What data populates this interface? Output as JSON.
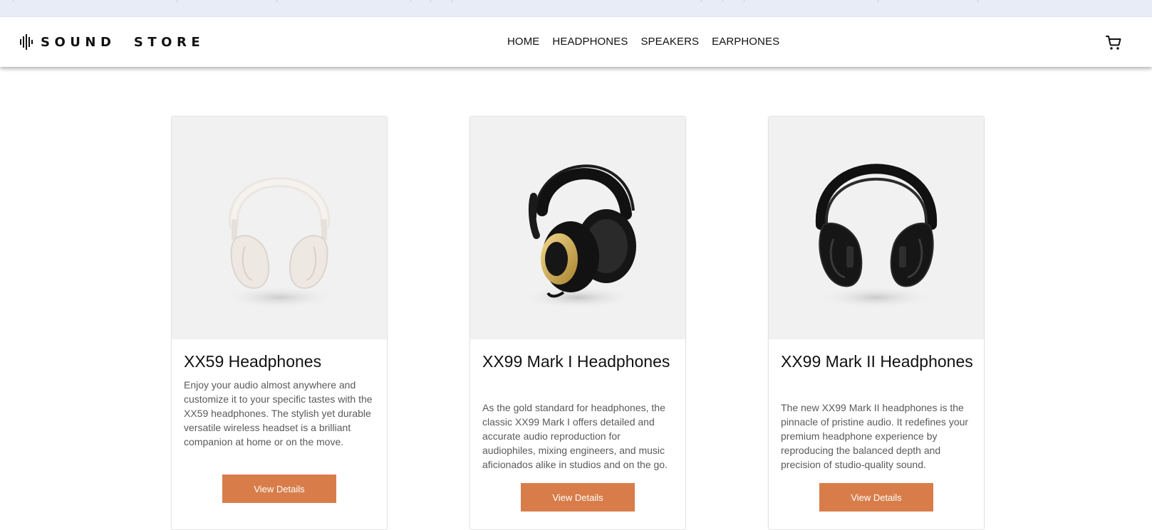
{
  "brand": {
    "logo_text": "SOUND  STORE",
    "logo_icon": "sound-wave-icon"
  },
  "nav": {
    "items": [
      {
        "label": "HOME"
      },
      {
        "label": "HEADPHONES"
      },
      {
        "label": "SPEAKERS"
      },
      {
        "label": "EARPHONES"
      }
    ],
    "cart_icon": "shopping-cart-icon"
  },
  "products": [
    {
      "title": "XX59 Headphones",
      "description": "Enjoy your audio almost anywhere and customize it to your specific tastes with the XX59 headphones. The stylish yet durable versatile wireless headset is a brilliant companion at home or on the move.",
      "button_label": "View Details",
      "image_icon": "white-headphones-image"
    },
    {
      "title": "XX99 Mark I Headphones",
      "description": "As the gold standard for headphones, the classic XX99 Mark I offers detailed and accurate audio reproduction for audiophiles, mixing engineers, and music aficionados alike in studios and on the go.",
      "button_label": "View Details",
      "image_icon": "black-gold-headphones-image"
    },
    {
      "title": "XX99 Mark II Headphones",
      "description": "The new XX99 Mark II headphones is the pinnacle of pristine audio. It redefines your premium headphone experience by reproducing the balanced depth and precision of studio-quality sound.",
      "button_label": "View Details",
      "image_icon": "black-headphones-image"
    }
  ],
  "colors": {
    "accent": "#d87d4a",
    "image_background": "#f1f1f1",
    "text_primary": "#111111",
    "text_secondary": "#5a5a5a"
  }
}
